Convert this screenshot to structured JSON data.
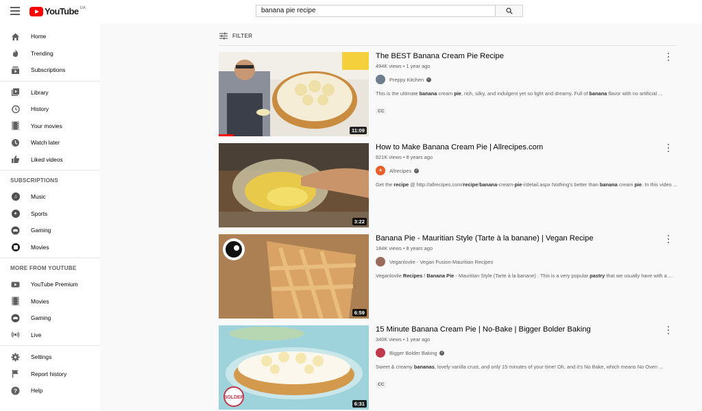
{
  "header": {
    "logo_text": "YouTube",
    "logo_region": "UA",
    "search_value": "banana pie recipe"
  },
  "sidebar": {
    "main": [
      {
        "label": "Home",
        "icon": "home-icon"
      },
      {
        "label": "Trending",
        "icon": "flame-icon"
      },
      {
        "label": "Subscriptions",
        "icon": "subscriptions-icon"
      }
    ],
    "library": [
      {
        "label": "Library",
        "icon": "library-icon"
      },
      {
        "label": "History",
        "icon": "history-icon"
      },
      {
        "label": "Your movies",
        "icon": "movies-icon"
      },
      {
        "label": "Watch later",
        "icon": "clock-icon"
      },
      {
        "label": "Liked videos",
        "icon": "thumbs-up-icon"
      }
    ],
    "subscriptions_heading": "SUBSCRIPTIONS",
    "subscriptions": [
      {
        "label": "Music",
        "icon": "music-icon"
      },
      {
        "label": "Sports",
        "icon": "sports-icon"
      },
      {
        "label": "Gaming",
        "icon": "gaming-icon"
      },
      {
        "label": "Movies",
        "icon": "movies-channel-icon"
      }
    ],
    "more_heading": "MORE FROM YOUTUBE",
    "more": [
      {
        "label": "YouTube Premium",
        "icon": "youtube-premium-icon"
      },
      {
        "label": "Movies",
        "icon": "movies-icon"
      },
      {
        "label": "Gaming",
        "icon": "gaming-icon"
      },
      {
        "label": "Live",
        "icon": "live-icon"
      }
    ],
    "footer": [
      {
        "label": "Settings",
        "icon": "gear-icon"
      },
      {
        "label": "Report history",
        "icon": "flag-icon"
      },
      {
        "label": "Help",
        "icon": "help-icon"
      }
    ]
  },
  "filter_label": "FILTER",
  "results": [
    {
      "title": "The BEST Banana Cream Pie Recipe",
      "meta": "494K views • 1 year ago",
      "channel": "Preppy Kitchen",
      "channel_color": "#6d7f8f",
      "desc_parts": [
        [
          "This is the ultimate ",
          false
        ],
        [
          "banana",
          true
        ],
        [
          " cream ",
          false
        ],
        [
          "pie",
          true
        ],
        [
          ", rich, silky, and indulgent yet so light and dreamy. Full of ",
          false
        ],
        [
          "banana",
          true
        ],
        [
          " flavor with no artificial ...",
          false
        ]
      ],
      "cc": "CC",
      "duration": "11:09",
      "watched": true
    },
    {
      "title": "How to Make Banana Cream Pie | Allrecipes.com",
      "meta": "821K views • 8 years ago",
      "channel": "Allrecipes",
      "channel_color": "#e8612c",
      "channel_initials": "a",
      "desc_parts": [
        [
          "Get the ",
          false
        ],
        [
          "recipe",
          true
        ],
        [
          " @ http://allrecipes.com/",
          false
        ],
        [
          "recipe",
          true
        ],
        [
          "/",
          false
        ],
        [
          "banana",
          true
        ],
        [
          "-cream-",
          false
        ],
        [
          "pie",
          true
        ],
        [
          "-i/detail.aspx Nothing's better than ",
          false
        ],
        [
          "banana",
          true
        ],
        [
          " cream ",
          false
        ],
        [
          "pie",
          true
        ],
        [
          ". In this video ...",
          false
        ]
      ],
      "duration": "3:22"
    },
    {
      "title": "Banana Pie - Mauritian Style (Tarte à la banane) | Vegan Recipe",
      "meta": "184K views • 8 years ago",
      "channel": "Veganlovlie - Vegan Fusion-Mauritian Recipes",
      "channel_color": "#9a6b5a",
      "desc_parts": [
        [
          "Veganlovlie ",
          false
        ],
        [
          "Recipes",
          true
        ],
        [
          " / ",
          false
        ],
        [
          "Banana Pie",
          true
        ],
        [
          " - Mauritian Style (Tarte à la banane) : This is a very popular ",
          false
        ],
        [
          "pastry",
          true
        ],
        [
          " that we usually have with a ...",
          false
        ]
      ],
      "duration": "6:59"
    },
    {
      "title": "15 Minute Banana Cream Pie | No-Bake | Bigger Bolder Baking",
      "meta": "340K views • 1 year ago",
      "channel": "Bigger Bolder Baking",
      "channel_color": "#c0394b",
      "desc_parts": [
        [
          "Sweet & creamy ",
          false
        ],
        [
          "bananas",
          true
        ],
        [
          ", lovely vanilla crust, and only 15 minutes of your time! Oh, and it's No Bake, which means No Oven ...",
          false
        ]
      ],
      "cc": "CC",
      "duration": "6:31"
    }
  ],
  "thumb_badge": "BOLDER"
}
